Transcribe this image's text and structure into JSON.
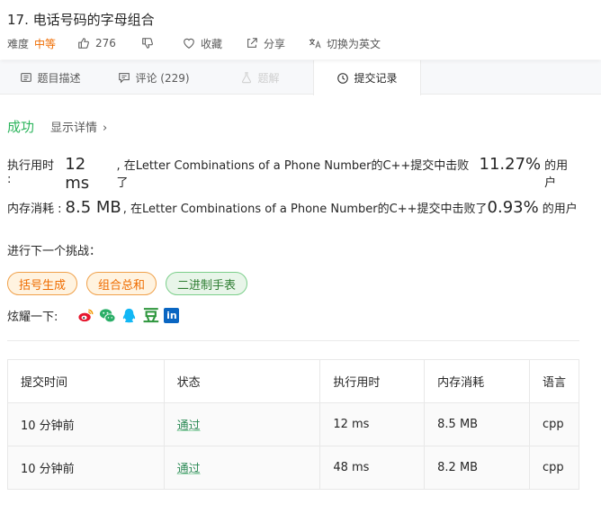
{
  "problem": {
    "title": "17. 电话号码的字母组合",
    "difficulty_label": "难度",
    "difficulty": "中等",
    "likes": "276",
    "favorite_label": "收藏",
    "share_label": "分享",
    "switch_lang_label": "切换为英文"
  },
  "tabs": [
    {
      "label": "题目描述"
    },
    {
      "label": "评论 (229)"
    },
    {
      "label": "题解"
    },
    {
      "label": "提交记录"
    }
  ],
  "result": {
    "status": "成功",
    "details_label": "显示详情",
    "runtime_label": "执行用时 :",
    "runtime_value": "12 ms",
    "runtime_text": ", 在Letter Combinations of a Phone Number的C++提交中击败了",
    "runtime_percent": "11.27%",
    "runtime_suffix": "的用户",
    "memory_label": "内存消耗 :",
    "memory_value": "8.5 MB",
    "memory_text": ", 在Letter Combinations of a Phone Number的C++提交中击败了",
    "memory_percent": "0.93%",
    "memory_suffix": "的用户"
  },
  "next": {
    "label": "进行下一个挑战：",
    "challenges": [
      "括号生成",
      "组合总和",
      "二进制手表"
    ]
  },
  "share": {
    "label": "炫耀一下:",
    "douban_glyph": "豆",
    "linkedin_glyph": "in"
  },
  "table": {
    "headers": [
      "提交时间",
      "状态",
      "执行用时",
      "内存消耗",
      "语言"
    ],
    "rows": [
      {
        "time": "10 分钟前",
        "status": "通过",
        "runtime": "12 ms",
        "memory": "8.5 MB",
        "lang": "cpp"
      },
      {
        "time": "10 分钟前",
        "status": "通过",
        "runtime": "48 ms",
        "memory": "8.2 MB",
        "lang": "cpp"
      }
    ]
  },
  "colors": {
    "success": "#2db55d",
    "difficulty_medium": "#ef6c00",
    "weibo": "#e6162d",
    "wechat": "#2aae67",
    "qq": "#12b7f5",
    "douban": "#2e963d",
    "linkedin": "#0a66c2"
  }
}
